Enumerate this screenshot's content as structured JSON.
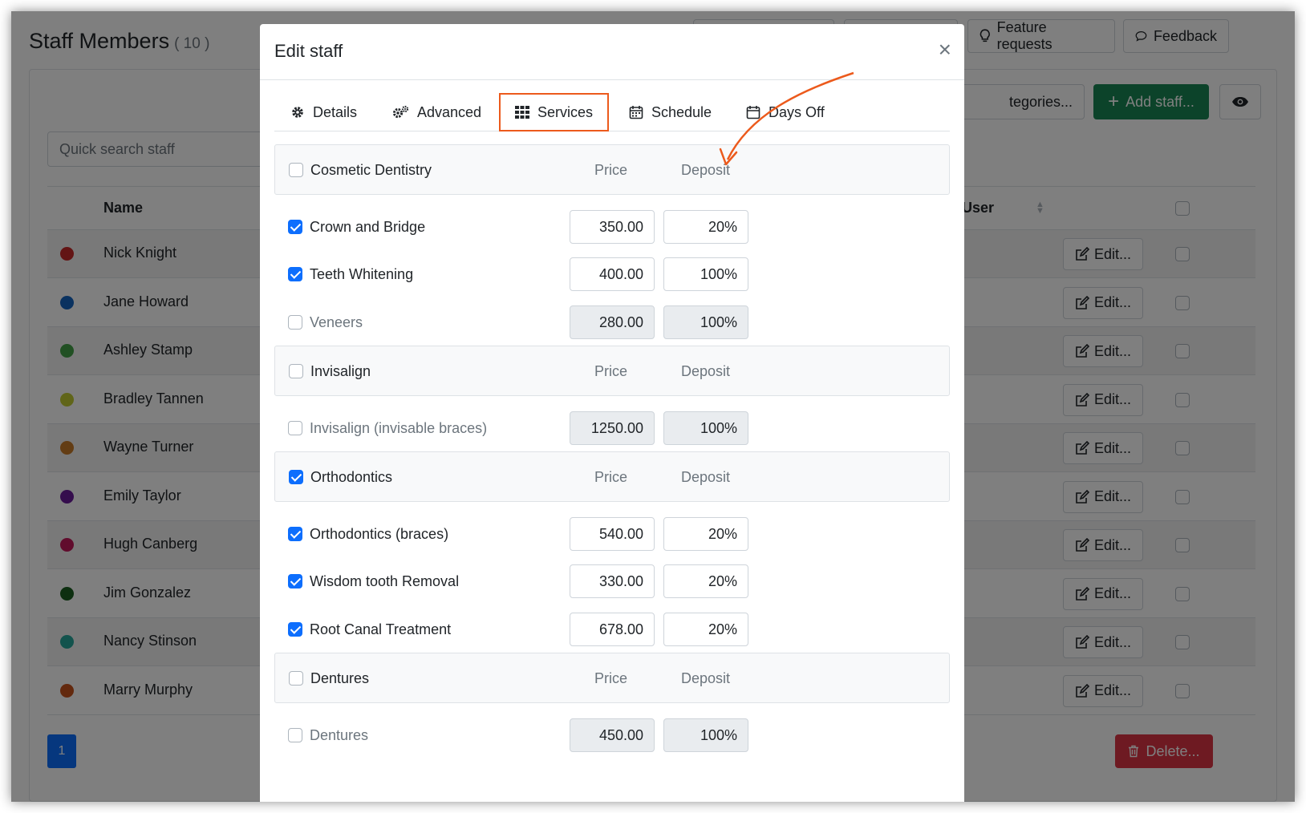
{
  "page": {
    "title": "Staff Members",
    "count": "( 10 )",
    "top_buttons": [
      "Feature requests",
      "Feedback"
    ],
    "search_placeholder": "Quick search staff",
    "categories_button": "tegories...",
    "add_staff_button": "Add staff...",
    "columns": {
      "name": "Name",
      "user": "User"
    },
    "rows": [
      {
        "name": "Nick Knight",
        "color": "#c62828",
        "edit": "Edit..."
      },
      {
        "name": "Jane Howard",
        "color": "#1565c0",
        "edit": "Edit..."
      },
      {
        "name": "Ashley Stamp",
        "color": "#43a047",
        "edit": "Edit..."
      },
      {
        "name": "Bradley Tannen",
        "color": "#c0ca33",
        "edit": "Edit..."
      },
      {
        "name": "Wayne Turner",
        "color": "#c77a28",
        "edit": "Edit..."
      },
      {
        "name": "Emily Taylor",
        "color": "#6a1b9a",
        "edit": "Edit..."
      },
      {
        "name": "Hugh Canberg",
        "color": "#c2185b",
        "edit": "Edit..."
      },
      {
        "name": "Jim Gonzalez",
        "color": "#1b5e20",
        "edit": "Edit..."
      },
      {
        "name": "Nancy Stinson",
        "color": "#26a69a",
        "edit": "Edit..."
      },
      {
        "name": "Marry Murphy",
        "color": "#c6521c",
        "edit": "Edit..."
      }
    ],
    "page_number": "1",
    "delete_button": "Delete..."
  },
  "modal": {
    "title": "Edit staff",
    "close": "×",
    "tabs": [
      {
        "label": "Details",
        "icon": "gear-icon"
      },
      {
        "label": "Advanced",
        "icon": "gears-icon"
      },
      {
        "label": "Services",
        "icon": "grid-icon",
        "active": true
      },
      {
        "label": "Schedule",
        "icon": "calendar-icon"
      },
      {
        "label": "Days Off",
        "icon": "calendar-blank-icon"
      }
    ],
    "groups": [
      {
        "name": "Cosmetic Dentistry",
        "checked": false,
        "price_header": "Price",
        "deposit_header": "Deposit",
        "services": [
          {
            "name": "Crown and Bridge",
            "checked": true,
            "price": "350.00",
            "deposit": "20%"
          },
          {
            "name": "Teeth Whitening",
            "checked": true,
            "price": "400.00",
            "deposit": "100%"
          },
          {
            "name": "Veneers",
            "checked": false,
            "price": "280.00",
            "deposit": "100%"
          }
        ]
      },
      {
        "name": "Invisalign",
        "checked": false,
        "price_header": "Price",
        "deposit_header": "Deposit",
        "services": [
          {
            "name": "Invisalign (invisable braces)",
            "checked": false,
            "price": "1250.00",
            "deposit": "100%"
          }
        ]
      },
      {
        "name": "Orthodontics",
        "checked": true,
        "price_header": "Price",
        "deposit_header": "Deposit",
        "services": [
          {
            "name": "Orthodontics (braces)",
            "checked": true,
            "price": "540.00",
            "deposit": "20%"
          },
          {
            "name": "Wisdom tooth Removal",
            "checked": true,
            "price": "330.00",
            "deposit": "20%"
          },
          {
            "name": "Root Canal Treatment",
            "checked": true,
            "price": "678.00",
            "deposit": "20%"
          }
        ]
      },
      {
        "name": "Dentures",
        "checked": false,
        "price_header": "Price",
        "deposit_header": "Deposit",
        "services": [
          {
            "name": "Dentures",
            "checked": false,
            "price": "450.00",
            "deposit": "100%"
          }
        ]
      }
    ]
  },
  "colors": {
    "primary": "#0d6efd",
    "success": "#198754",
    "danger": "#dc3545",
    "highlight": "#ec5a1c"
  }
}
